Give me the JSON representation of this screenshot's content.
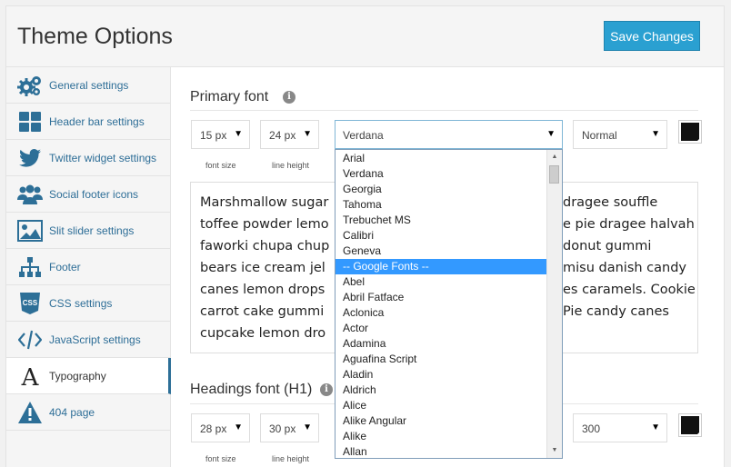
{
  "header": {
    "title": "Theme Options",
    "save_label": "Save Changes"
  },
  "sidebar": {
    "items": [
      {
        "label": "General settings",
        "icon": "gears-icon"
      },
      {
        "label": "Header bar settings",
        "icon": "grid-icon"
      },
      {
        "label": "Twitter widget settings",
        "icon": "twitter-icon"
      },
      {
        "label": "Social footer icons",
        "icon": "users-icon"
      },
      {
        "label": "Slit slider settings",
        "icon": "image-icon"
      },
      {
        "label": "Footer",
        "icon": "sitemap-icon"
      },
      {
        "label": "CSS settings",
        "icon": "css-icon"
      },
      {
        "label": "JavaScript settings",
        "icon": "code-icon"
      },
      {
        "label": "Typography",
        "icon": "typography-icon",
        "active": true
      },
      {
        "label": "404 page",
        "icon": "warning-icon"
      }
    ]
  },
  "primary": {
    "title": "Primary font",
    "font_size": "15 px",
    "line_height": "24 px",
    "font_family": "Verdana",
    "weight": "Normal",
    "font_size_label": "font size",
    "line_height_label": "line height",
    "color": "#111111",
    "preview": "Marshmallow sugar plum chocolate cake dragee souffle toffee powder lemon drops toffee apple pie dragee halvah faworki chupa chups donut gummi bears ice cream jelly beans tiramisu danish candy canes lemon drops caramels. Cookie carrot cake gummi bears Pie candy canes cupcake lemon drops.",
    "preview_lines": [
      "Marshmallow sugar",
      "toffee powder lemo",
      "faworki chupa chup",
      "bears ice cream jel",
      "canes lemon drops",
      "carrot cake gummi",
      "cupcake lemon dro"
    ],
    "preview_lines_right": [
      "dragee souffle",
      "e pie dragee halvah",
      "donut gummi",
      "misu danish candy",
      "es caramels. Cookie",
      "Pie candy canes",
      ""
    ]
  },
  "font_options": [
    "Arial",
    "Verdana",
    "Georgia",
    "Tahoma",
    "Trebuchet MS",
    "Calibri",
    "Geneva",
    "-- Google Fonts --",
    "Abel",
    "Abril Fatface",
    "Aclonica",
    "Actor",
    "Adamina",
    "Aguafina Script",
    "Aladin",
    "Aldrich",
    "Alice",
    "Alike Angular",
    "Alike",
    "Allan"
  ],
  "highlighted_option": "-- Google Fonts --",
  "headings": {
    "title": "Headings font (H1)",
    "font_size": "28 px",
    "line_height": "30 px",
    "weight": "300",
    "font_size_label": "font size",
    "line_height_label": "line height",
    "color": "#111111"
  },
  "colors": {
    "accent": "#2aa0d1",
    "link": "#2e6e97",
    "highlight": "#3399ff"
  }
}
